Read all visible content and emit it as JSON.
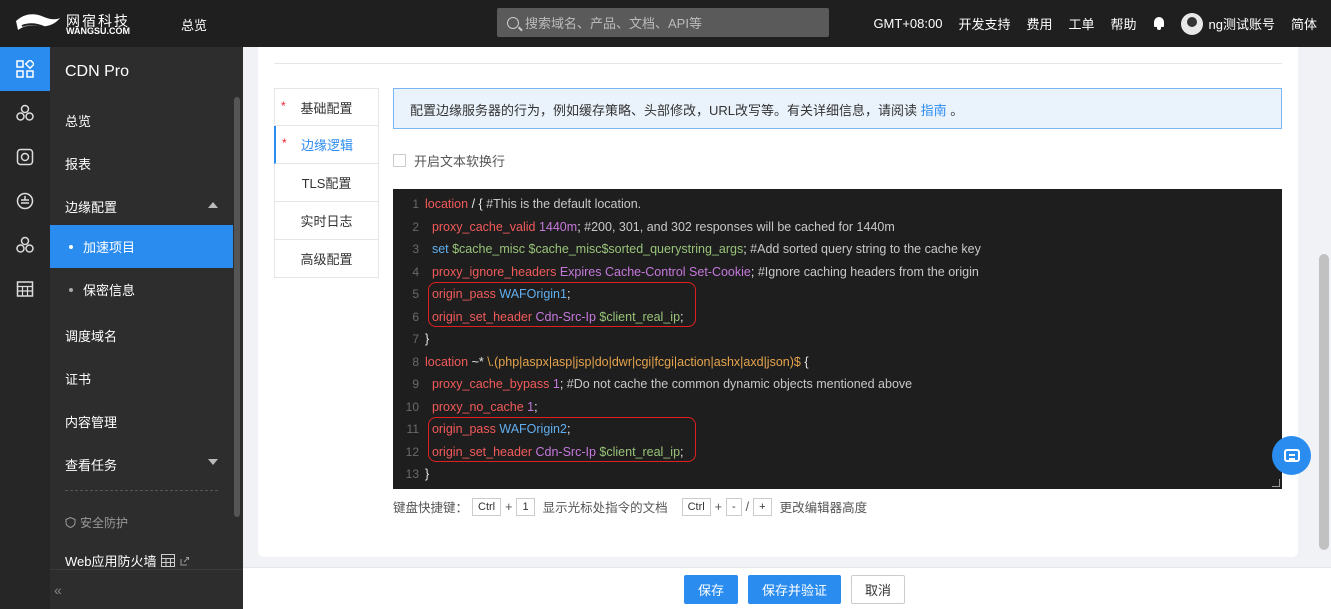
{
  "topbar": {
    "logo_cn": "网宿科技",
    "logo_en": "WANGSU.COM",
    "overview": "总览",
    "search_placeholder": "搜索域名、产品、文档、API等",
    "timezone": "GMT+08:00",
    "dev_support": "开发支持",
    "billing": "费用",
    "tickets": "工单",
    "help": "帮助",
    "account": "ng测试账号",
    "language": "简体"
  },
  "sidebar": {
    "product": "CDN Pro",
    "items": {
      "overview": "总览",
      "reports": "报表",
      "edge_config": "边缘配置",
      "acceleration_project": "加速项目",
      "secrets": "保密信息",
      "scheduling_domain": "调度域名",
      "certificates": "证书",
      "content_mgmt": "内容管理",
      "view_tasks": "查看任务",
      "security": "安全防护",
      "waf": "Web应用防火墙"
    }
  },
  "tabs": {
    "basic": "基础配置",
    "edge_logic": "边缘逻辑",
    "tls": "TLS配置",
    "realtime_log": "实时日志",
    "advanced": "高级配置"
  },
  "info": {
    "text": "配置边缘服务器的行为，例如缓存策略、头部修改，URL改写等。有关详细信息，请阅读 ",
    "link": "指南",
    "suffix": " 。"
  },
  "wrap_option": "开启文本软换行",
  "editor": {
    "line_numbers": [
      "1",
      "2",
      "3",
      "4",
      "5",
      "6",
      "7",
      "8",
      "9",
      "10",
      "11",
      "12",
      "13"
    ]
  },
  "shortcuts": {
    "label": "键盘快捷键：",
    "ctrl": "Ctrl",
    "plus": "+",
    "one": "1",
    "desc1": "显示光标处指令的文档",
    "minus": "-",
    "slash": "/",
    "desc2": "更改编辑器高度"
  },
  "footer": {
    "save": "保存",
    "save_verify": "保存并验证",
    "cancel": "取消"
  },
  "colors": {
    "accent": "#2b8cf0",
    "highlight_box": "#e02020",
    "keyword": "#f25a5a"
  }
}
